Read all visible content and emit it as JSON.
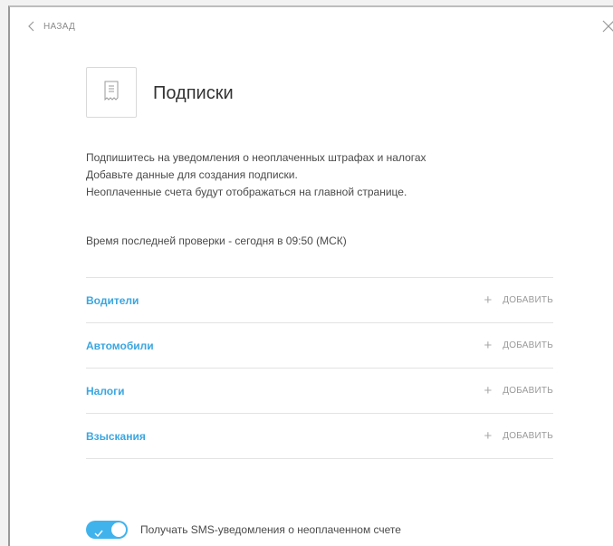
{
  "header": {
    "back_label": "НАЗАД",
    "back_icon": "chevron-left-icon",
    "close_icon": "close-icon"
  },
  "page": {
    "icon": "document-icon",
    "title": "Подписки",
    "description": [
      "Подпишитесь на уведомления о неоплаченных штрафах и налогах",
      "Добавьте данные для создания подписки.",
      "Неоплаченные счета будут отображаться на главной странице."
    ],
    "last_check": "Время последней проверки - сегодня в 09:50 (МСК)"
  },
  "sections": [
    {
      "label": "Водители",
      "action_icon": "plus-icon",
      "action_label": "ДОБАВИТЬ"
    },
    {
      "label": "Автомобили",
      "action_icon": "plus-icon",
      "action_label": "ДОБАВИТЬ"
    },
    {
      "label": "Налоги",
      "action_icon": "plus-icon",
      "action_label": "ДОБАВИТЬ"
    },
    {
      "label": "Взыскания",
      "action_icon": "plus-icon",
      "action_label": "ДОБАВИТЬ"
    }
  ],
  "sms": {
    "enabled": true,
    "label": "Получать SMS-уведомления о неоплаченном счете"
  },
  "colors": {
    "accent": "#41b3ec",
    "link": "#3aa6e0",
    "text": "#4a4a4a",
    "muted": "#9a9a9a"
  }
}
